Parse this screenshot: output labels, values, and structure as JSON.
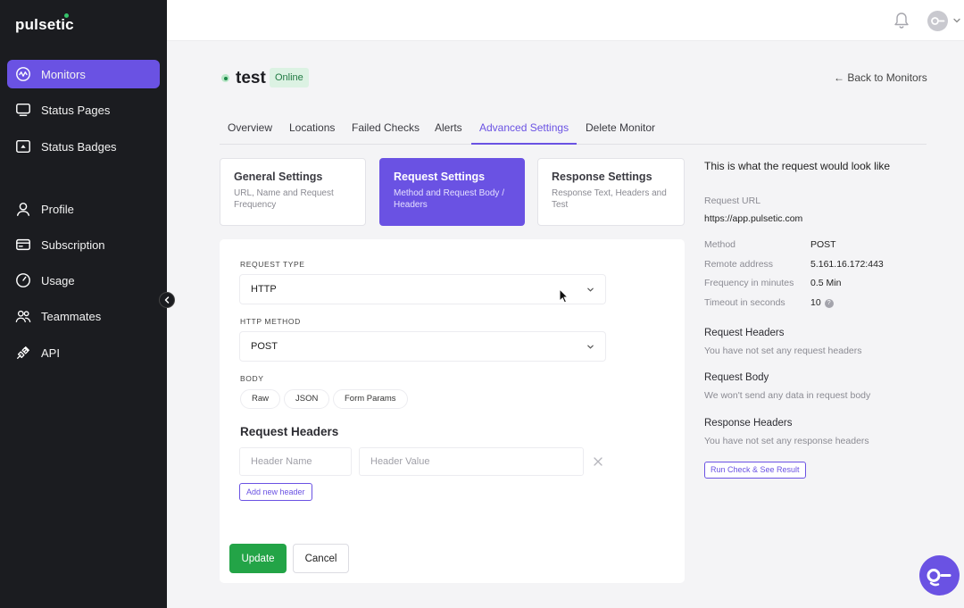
{
  "app": {
    "logo": "pulsetic"
  },
  "sidebar": {
    "items": [
      {
        "label": "Monitors",
        "icon": "monitors-icon"
      },
      {
        "label": "Status Pages",
        "icon": "status-pages-icon"
      },
      {
        "label": "Status Badges",
        "icon": "status-badges-icon"
      },
      {
        "label": "Profile",
        "icon": "profile-icon"
      },
      {
        "label": "Subscription",
        "icon": "subscription-icon"
      },
      {
        "label": "Usage",
        "icon": "usage-icon"
      },
      {
        "label": "Teammates",
        "icon": "teammates-icon"
      },
      {
        "label": "API",
        "icon": "api-icon"
      }
    ]
  },
  "header": {
    "monitor_name": "test",
    "status": "Online",
    "back_link": "← Back to Monitors"
  },
  "tabs": [
    "Overview",
    "Locations",
    "Failed Checks",
    "Alerts",
    "Advanced Settings",
    "Delete Monitor"
  ],
  "cards": [
    {
      "title": "General Settings",
      "desc": "URL, Name and Request Frequency"
    },
    {
      "title": "Request Settings",
      "desc": "Method and Request Body / Headers"
    },
    {
      "title": "Response Settings",
      "desc": "Response Text, Headers and Test"
    }
  ],
  "form": {
    "request_type_label": "REQUEST TYPE",
    "request_type_value": "HTTP",
    "http_method_label": "HTTP METHOD",
    "http_method_value": "POST",
    "body_label": "BODY",
    "body_options": [
      "Raw",
      "JSON",
      "Form Params"
    ],
    "request_headers_title": "Request Headers",
    "header_name_placeholder": "Header Name",
    "header_value_placeholder": "Header Value",
    "add_header_label": "Add new header",
    "update_label": "Update",
    "cancel_label": "Cancel"
  },
  "preview": {
    "title": "This is what the request would look like",
    "request_url_label": "Request URL",
    "request_url": "https://app.pulsetic.com",
    "method_label": "Method",
    "method": "POST",
    "remote_address_label": "Remote address",
    "remote_address": "5.161.16.172:443",
    "frequency_label": "Frequency in minutes",
    "frequency": "0.5 Min",
    "timeout_label": "Timeout in seconds",
    "timeout": "10",
    "request_headers_title": "Request Headers",
    "request_headers_text": "You have not set any request headers",
    "request_body_title": "Request Body",
    "request_body_text": "We won't send any data in request body",
    "response_headers_title": "Response Headers",
    "response_headers_text": "You have not set any response headers",
    "run_button": "Run Check & See Result"
  },
  "colors": {
    "accent": "#6a52e3",
    "sidebar_bg": "#1b1c20",
    "success": "#23a447",
    "online_badge_bg": "#dcf2e3"
  }
}
